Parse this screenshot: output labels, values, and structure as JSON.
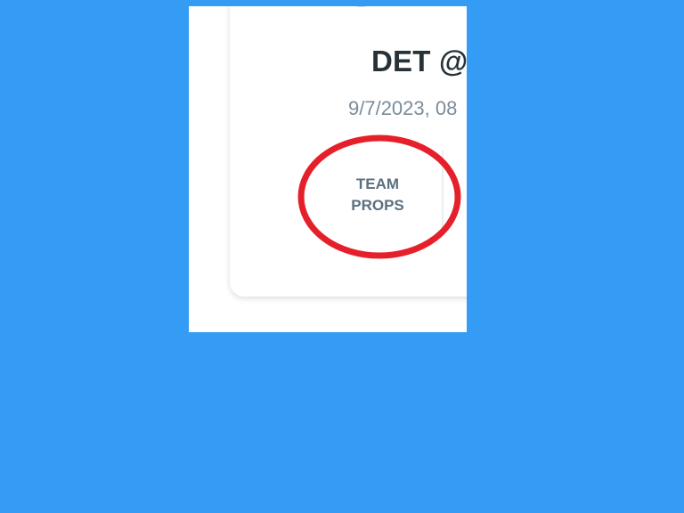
{
  "game_card": {
    "matchup": "DET @",
    "datetime": "9/7/2023, 08"
  },
  "tabs": {
    "team_props_line1": "TEAM",
    "team_props_line2": "PROPS"
  },
  "annotation": {
    "highlight_color": "#e5202a"
  },
  "colors": {
    "background": "#349cf5",
    "card": "#ffffff",
    "title": "#263238",
    "datetime": "#7b8c99",
    "tab_text": "#5a7080"
  }
}
